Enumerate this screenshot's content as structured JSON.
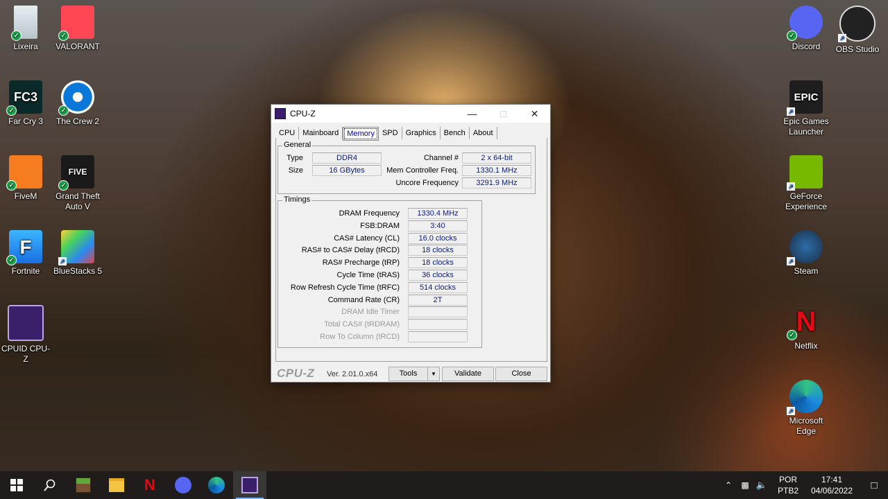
{
  "desktop_icons": {
    "left": [
      {
        "label": "Lixeira",
        "icon": "recycle-bin-icon"
      },
      {
        "label": "VALORANT",
        "icon": "valorant-icon"
      },
      {
        "label": "Far Cry 3",
        "icon": "farcry3-icon",
        "logo": "FC3"
      },
      {
        "label": "The Crew 2",
        "icon": "ubisoft-icon"
      },
      {
        "label": "FiveM",
        "icon": "fivem-icon"
      },
      {
        "label": "Grand Theft Auto V",
        "icon": "gta5-icon",
        "logo": "FIVE"
      },
      {
        "label": "Fortnite",
        "icon": "fortnite-icon",
        "logo": "F"
      },
      {
        "label": "BlueStacks 5",
        "icon": "bluestacks-icon"
      },
      {
        "label": "CPUID CPU-Z",
        "icon": "cpuz-icon"
      }
    ],
    "right": [
      {
        "label": "Discord",
        "icon": "discord-icon"
      },
      {
        "label": "OBS Studio",
        "icon": "obs-icon"
      },
      {
        "label": "Epic Games Launcher",
        "icon": "epic-games-icon",
        "logo": "EPIC"
      },
      {
        "label": "GeForce Experience",
        "icon": "nvidia-icon"
      },
      {
        "label": "Steam",
        "icon": "steam-icon"
      },
      {
        "label": "Netflix",
        "icon": "netflix-icon",
        "logo": "N"
      },
      {
        "label": "Microsoft Edge",
        "icon": "edge-icon"
      }
    ]
  },
  "window": {
    "title": "CPU-Z",
    "tabs": [
      "CPU",
      "Mainboard",
      "Memory",
      "SPD",
      "Graphics",
      "Bench",
      "About"
    ],
    "active_tab": "Memory",
    "general": {
      "legend": "General",
      "type_label": "Type",
      "type_value": "DDR4",
      "size_label": "Size",
      "size_value": "16 GBytes",
      "channel_label": "Channel #",
      "channel_value": "2 x 64-bit",
      "mcf_label": "Mem Controller Freq.",
      "mcf_value": "1330.1 MHz",
      "uncore_label": "Uncore Frequency",
      "uncore_value": "3291.9 MHz"
    },
    "timings": {
      "legend": "Timings",
      "rows": [
        {
          "label": "DRAM Frequency",
          "value": "1330.4 MHz",
          "disabled": false
        },
        {
          "label": "FSB:DRAM",
          "value": "3:40",
          "disabled": false
        },
        {
          "label": "CAS# Latency (CL)",
          "value": "16.0 clocks",
          "disabled": false
        },
        {
          "label": "RAS# to CAS# Delay (tRCD)",
          "value": "18 clocks",
          "disabled": false
        },
        {
          "label": "RAS# Precharge (tRP)",
          "value": "18 clocks",
          "disabled": false
        },
        {
          "label": "Cycle Time (tRAS)",
          "value": "36 clocks",
          "disabled": false
        },
        {
          "label": "Row Refresh Cycle Time (tRFC)",
          "value": "514 clocks",
          "disabled": false
        },
        {
          "label": "Command Rate (CR)",
          "value": "2T",
          "disabled": false
        },
        {
          "label": "DRAM Idle Timer",
          "value": "",
          "disabled": true
        },
        {
          "label": "Total CAS# (tRDRAM)",
          "value": "",
          "disabled": true
        },
        {
          "label": "Row To Column (tRCD)",
          "value": "",
          "disabled": true
        }
      ]
    },
    "footer": {
      "brand": "CPU-Z",
      "version": "Ver. 2.01.0.x64",
      "tools": "Tools",
      "validate": "Validate",
      "close": "Close"
    }
  },
  "taskbar": {
    "apps": [
      "start-icon",
      "search-icon",
      "minecraft-icon",
      "file-explorer-icon",
      "netflix-icon",
      "discord-icon",
      "edge-icon",
      "cpuz-icon"
    ],
    "language_line1": "POR",
    "language_line2": "PTB2",
    "time": "17:41",
    "date": "04/06/2022"
  },
  "colors": {
    "value_text": "#0a1a80",
    "taskbar": "#1f1c1b",
    "accent": "#78b4ff"
  }
}
